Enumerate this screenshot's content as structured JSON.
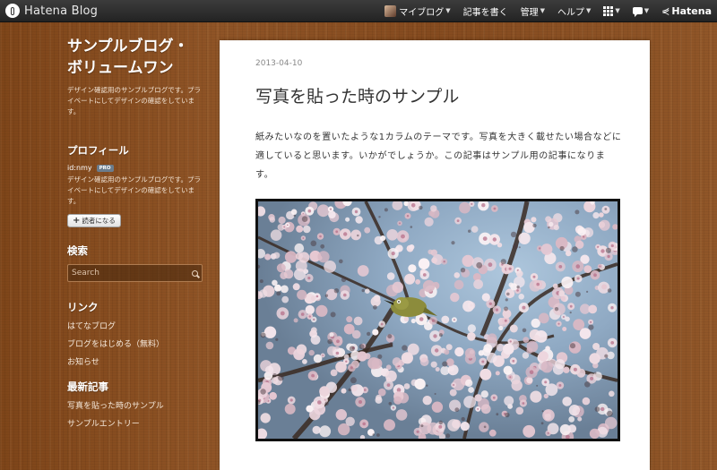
{
  "topbar": {
    "brand": "Hatena Blog",
    "nav": [
      {
        "id": "my-blog",
        "label": "マイブログ"
      },
      {
        "id": "write",
        "label": "記事を書く"
      },
      {
        "id": "manage",
        "label": "管理"
      },
      {
        "id": "help",
        "label": "ヘルプ"
      }
    ],
    "hatena_label": "Hatena"
  },
  "sidebar": {
    "blog_title_line1": "サンプルブログ・",
    "blog_title_line2": "ボリュームワン",
    "blog_description": "デザイン確認用のサンプルブログです。プライベートにしてデザインの確認をしています。",
    "profile": {
      "heading": "プロフィール",
      "user_id": "id:nmy",
      "badge": "PRO",
      "description": "デザイン確認用のサンプルブログです。プライベートにしてデザインの確認をしています。",
      "subscribe_label": "読者になる"
    },
    "search": {
      "heading": "検索",
      "placeholder": "Search"
    },
    "links": {
      "heading": "リンク",
      "items": [
        "はてなブログ",
        "ブログをはじめる（無料）",
        "お知らせ"
      ]
    },
    "recent": {
      "heading": "最新記事",
      "items": [
        "写真を貼った時のサンプル",
        "サンプルエントリー"
      ]
    }
  },
  "post": {
    "date": "2013-04-10",
    "title": "写真を貼った時のサンプル",
    "body": "紙みたいなのを置いたような1カラムのテーマです。写真を大きく載せたい場合などに適していると思います。いかがでしょうか。この記事はサンプル用の記事になります。",
    "photo_icon": "cherry-blossom-photo"
  },
  "colors": {
    "background_wood": "#8a4f22",
    "topbar": "#2e2e2e",
    "card": "#ffffff",
    "text": "#333333",
    "date": "#888888"
  }
}
